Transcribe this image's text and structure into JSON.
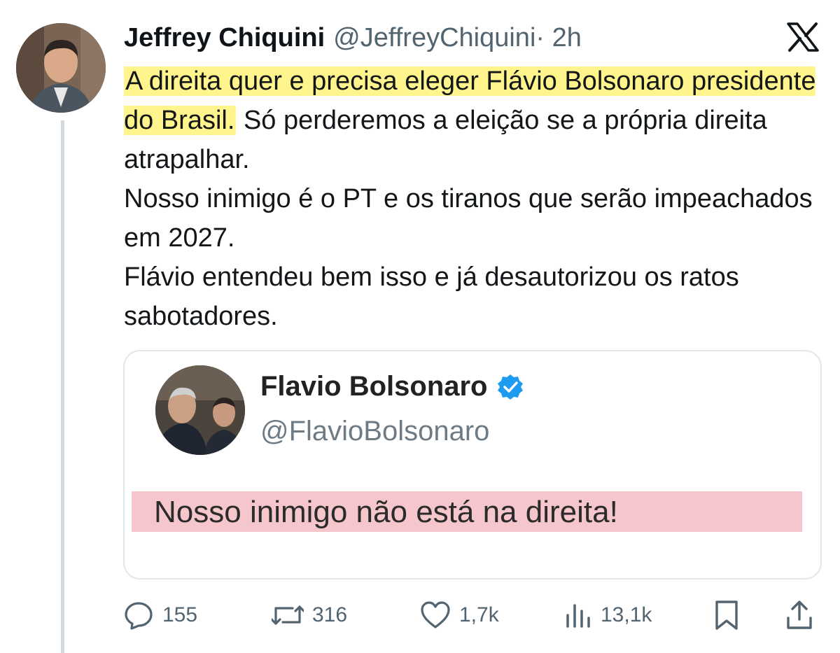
{
  "tweet": {
    "author_name": "Jeffrey Chiquini",
    "author_handle": "@JeffreyChiquini",
    "time": "· 2h",
    "highlighted_text": "A direita quer e precisa eleger Flávio Bolsonaro presidente do Brasil.",
    "text_rest": " Só perderemos a eleição se a própria direita atrapalhar.",
    "paragraph_2": "Nosso inimigo é o PT e os tiranos que serão impeachados em 2027.",
    "paragraph_3": "Flávio entendeu bem isso e já desautorizou os ratos sabotadores."
  },
  "quote": {
    "name": "Flavio Bolsonaro",
    "handle": "@FlavioBolsonaro",
    "text": "Nosso inimigo não está na direita!"
  },
  "actions": {
    "replies": "155",
    "reposts": "316",
    "likes": "1,7k",
    "views": "13,1k"
  },
  "colors": {
    "highlight": "#fff58c",
    "quote_highlight": "#f5c6cc",
    "verified": "#1d9bf0",
    "muted": "#536471"
  },
  "icons": [
    "x-logo-icon",
    "verified-badge-icon",
    "reply-icon",
    "repost-icon",
    "like-icon",
    "views-icon",
    "bookmark-icon",
    "share-icon"
  ]
}
